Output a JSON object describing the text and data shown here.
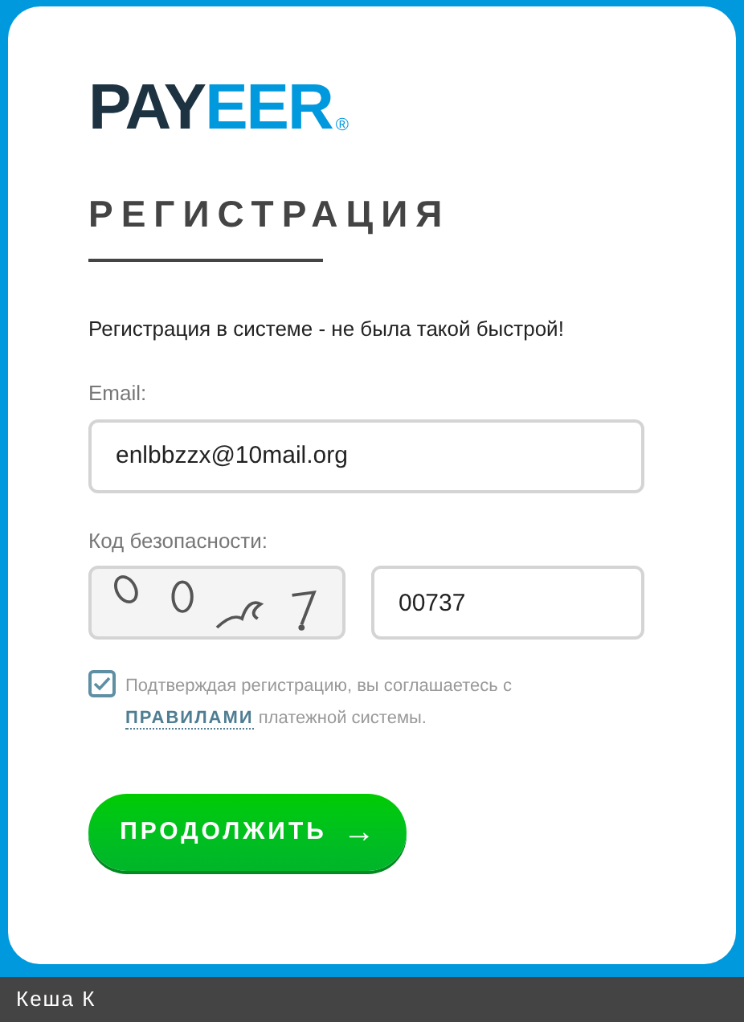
{
  "logo": {
    "dark": "PAY",
    "accent": "EER",
    "mark": "®"
  },
  "heading": "РЕГИСТРАЦИЯ",
  "intro": "Регистрация в системе - не была такой быстрой!",
  "email": {
    "label": "Email:",
    "value": "enlbbzzx@10mail.org"
  },
  "security": {
    "label": "Код безопасности:",
    "value": "00737"
  },
  "agreement": {
    "checked": true,
    "text_before": "Подтверждая регистрацию, вы соглашаетесь с",
    "link": "ПРАВИЛАМИ",
    "text_after": "платежной системы."
  },
  "submit": {
    "label": "ПРОДОЛЖИТЬ",
    "arrow": "→"
  },
  "footer": {
    "user": "Кеша К"
  }
}
